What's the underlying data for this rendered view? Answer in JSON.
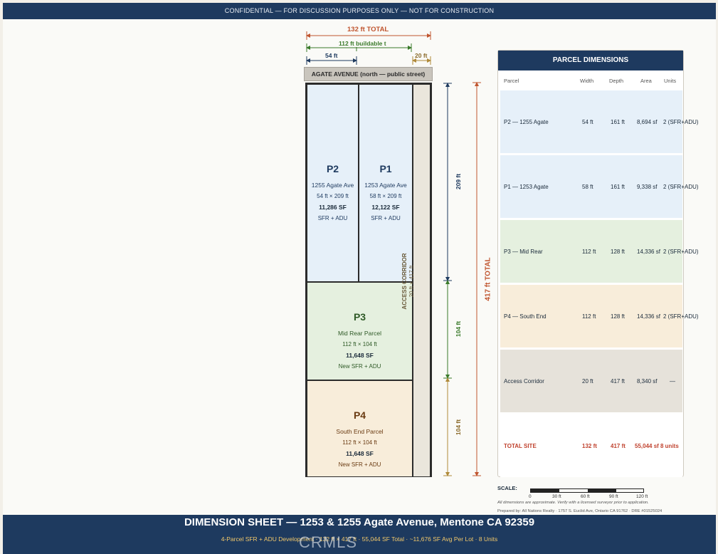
{
  "topbar": {
    "text": "CONFIDENTIAL — FOR DISCUSSION PURPOSES ONLY — NOT FOR CONSTRUCTION"
  },
  "dimensions": {
    "total_width": "132 ft  TOTAL",
    "buildable_width": "112 ft  buildable        t",
    "p2_width": "54 ft",
    "corridor_width": "20 ft",
    "p12_depth": "209 ft",
    "p3_depth": "104 ft",
    "p4_depth": "104 ft",
    "total_depth": "417 ft  TOTAL"
  },
  "street": {
    "label": "AGATE AVENUE  (north — public street)"
  },
  "parcels": {
    "p2": {
      "name": "P2",
      "address": "1255 Agate Ave",
      "dims": "54 ft × 209 ft",
      "area": "11,286 SF",
      "use": "SFR + ADU"
    },
    "p1": {
      "name": "P1",
      "address": "1253 Agate Ave",
      "dims": "58 ft × 209 ft",
      "area": "12,122 SF",
      "use": "SFR + ADU"
    },
    "p3": {
      "name": "P3",
      "address": "Mid Rear Parcel",
      "dims": "112 ft × 104 ft",
      "area": "11,648 SF",
      "use": "New SFR + ADU"
    },
    "p4": {
      "name": "P4",
      "address": "South End Parcel",
      "dims": "112 ft × 104 ft",
      "area": "11,648 SF",
      "use": "New SFR + ADU"
    }
  },
  "corridor": {
    "name": "ACCESS CORRIDOR",
    "dims": "20 ft × 417 ft"
  },
  "table": {
    "title": "PARCEL DIMENSIONS",
    "headers": {
      "parcel": "Parcel",
      "width": "Width",
      "depth": "Depth",
      "area": "Area",
      "units": "Units"
    },
    "rows": [
      {
        "parcel": "P2 — 1255 Agate",
        "width": "54 ft",
        "depth": "161 ft",
        "area": "8,694 sf",
        "units": "2 (SFR+ADU)"
      },
      {
        "parcel": "P1 — 1253 Agate",
        "width": "58 ft",
        "depth": "161 ft",
        "area": "9,338 sf",
        "units": "2 (SFR+ADU)"
      },
      {
        "parcel": "P3 — Mid Rear",
        "width": "112 ft",
        "depth": "128 ft",
        "area": "14,336 sf",
        "units": "2 (SFR+ADU)"
      },
      {
        "parcel": "P4 — South End",
        "width": "112 ft",
        "depth": "128 ft",
        "area": "14,336 sf",
        "units": "2 (SFR+ADU)"
      },
      {
        "parcel": "Access Corridor",
        "width": "20 ft",
        "depth": "417 ft",
        "area": "8,340 sf",
        "units": "—"
      },
      {
        "parcel": "TOTAL SITE",
        "width": "132 ft",
        "depth": "417 ft",
        "area": "55,044 sf",
        "units": "8 units"
      }
    ]
  },
  "scale": {
    "label": "SCALE:",
    "ticks": [
      "0",
      "30 ft",
      "60 ft",
      "90 ft",
      "120 ft"
    ],
    "note": "All dimensions are approximate. Verify with a licensed surveyor prior to application.",
    "prepared": "Prepared by: All Nations Realty  ·  1757 S. Euclid Ave, Ontario CA 91762  ·  DRE #01525024"
  },
  "footer": {
    "title": "DIMENSION SHEET  —  1253 & 1255 Agate Avenue, Mentone CA 92359",
    "subtitle": "4-Parcel SFR + ADU Development  ·  132 ft × 417 ft  ·  55,044 SF Total  ·  ~11,676 SF Avg Per Lot  ·  8 Units",
    "watermark": "CRMLS"
  },
  "colors": {
    "navy": "#1e3a5f",
    "dim_total": "#c0552f",
    "dim_buildable": "#3a7a2a",
    "dim_p2": "#1e3a5f",
    "dim_corridor": "#b08a3a",
    "blue_fill": "#e6f0f9",
    "green_fill": "#e5f0df",
    "orange_fill": "#f8edda",
    "corridor_fill": "#eae6dc"
  }
}
